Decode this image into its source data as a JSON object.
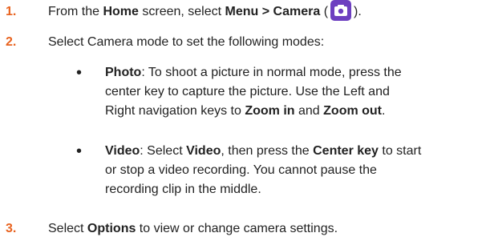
{
  "colors": {
    "step_number": "#e8621e",
    "camera_icon_bg": "#6d3fc0"
  },
  "steps": [
    {
      "number": "1.",
      "parts": [
        "From the ",
        "Home",
        " screen, select ",
        "Menu > Camera",
        " (",
        ")."
      ],
      "icon": "camera-icon"
    },
    {
      "number": "2.",
      "text": "Select Camera mode to set the following modes:"
    },
    {
      "number": "3.",
      "parts": [
        "Select ",
        "Options",
        " to view or change camera settings."
      ]
    }
  ],
  "modes": [
    {
      "lines": [
        [
          "Photo",
          ": To shoot a picture in normal mode, press the"
        ],
        [
          "center key to capture the picture. Use the Left and"
        ],
        [
          "Right navigation keys to ",
          "Zoom in",
          " and ",
          "Zoom out",
          "."
        ]
      ]
    },
    {
      "lines": [
        [
          "Video",
          ": Select ",
          "Video",
          ", then press the ",
          "Center key",
          " to start"
        ],
        [
          "or stop a video recording. You cannot pause the"
        ],
        [
          "recording clip in the middle."
        ]
      ]
    }
  ],
  "bullet_glyph": "•"
}
